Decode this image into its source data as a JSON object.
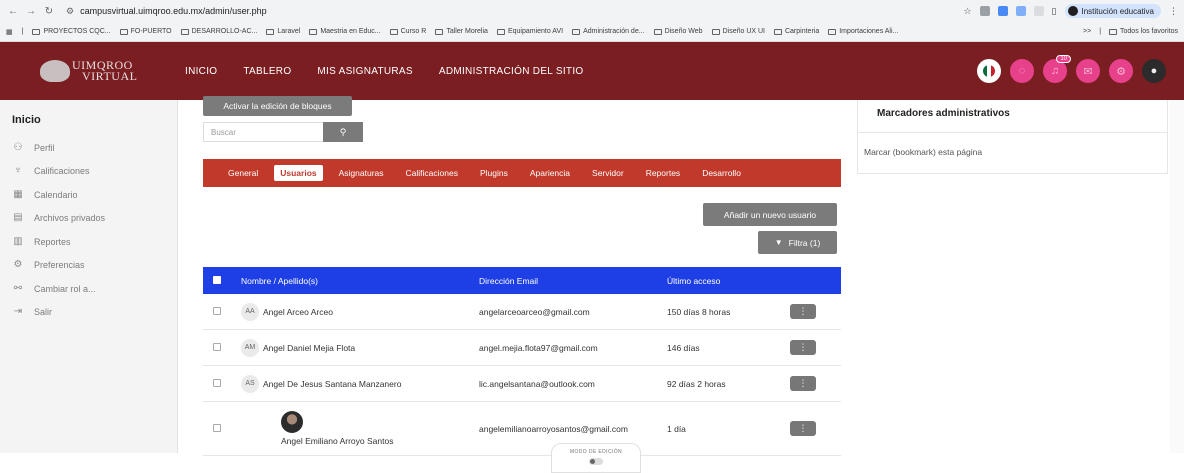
{
  "browser": {
    "url": "campusvirtual.uimqroo.edu.mx/admin/user.php",
    "profile_label": "Institución educativa",
    "bookmarks": [
      "PROYECTOS CQC...",
      "FO-PUERTO",
      "DESARROLLO-AC...",
      "Laravel",
      "Maestria en Educ...",
      "Curso R",
      "Taller Morelia",
      "Equipamiento AVI",
      "Administración de...",
      "Diseño Web",
      "Diseño UX UI",
      "Carpinteria",
      "Importaciones Ali..."
    ],
    "more_label": ">>",
    "all_bookmarks": "Todos los favoritos"
  },
  "header": {
    "logo_line1": "UIMQROO",
    "logo_line2": "VIRTUAL",
    "nav": [
      "INICIO",
      "TABLERO",
      "MIS ASIGNATURAS",
      "ADMINISTRACIÓN DEL SITIO"
    ],
    "notification_count": "10",
    "colors": {
      "header_bg": "#7a1e22",
      "icon_bg": "#e8418b"
    }
  },
  "sidebar": {
    "title": "Inicio",
    "items": [
      {
        "label": "Perfil",
        "icon": "profile-icon"
      },
      {
        "label": "Calificaciones",
        "icon": "grades-icon"
      },
      {
        "label": "Calendario",
        "icon": "calendar-icon"
      },
      {
        "label": "Archivos privados",
        "icon": "file-icon"
      },
      {
        "label": "Reportes",
        "icon": "reports-icon"
      },
      {
        "label": "Preferencias",
        "icon": "gear-icon"
      },
      {
        "label": "Cambiar rol a...",
        "icon": "switch-role-icon"
      },
      {
        "label": "Salir",
        "icon": "logout-icon"
      }
    ]
  },
  "main": {
    "edit_blocks_button": "Activar la edición de bloques",
    "search_placeholder": "Buscar",
    "tabs": [
      "General",
      "Usuarios",
      "Asignaturas",
      "Calificaciones",
      "Plugins",
      "Apariencia",
      "Servidor",
      "Reportes",
      "Desarrollo"
    ],
    "active_tab": "Usuarios",
    "add_user_button": "Añadir un nuevo usuario",
    "filter_button": "Filtra (1)",
    "columns": [
      "Nombre / Apellido(s)",
      "Dirección Email",
      "Último acceso"
    ],
    "users": [
      {
        "initials": "AA",
        "name": "Angel Arceo Arceo",
        "email": "angelarceoarceo@gmail.com",
        "last_access": "150 días 8 horas"
      },
      {
        "initials": "AM",
        "name": "Angel Daniel Mejia Flota",
        "email": "angel.mejia.flota97@gmail.com",
        "last_access": "146 días"
      },
      {
        "initials": "AS",
        "name": "Angel De Jesus Santana Manzanero",
        "email": "lic.angelsantana@outlook.com",
        "last_access": "92 días 2 horas"
      },
      {
        "initials": "",
        "name": "Angel Emiliano Arroyo Santos",
        "email": "angelemilianoarroyosantos@gmail.com",
        "last_access": "1 día"
      }
    ],
    "edit_mode_label": "MODO DE EDICIÓN",
    "colors": {
      "tabs_bg": "#c0392b",
      "table_header_bg": "#1f3fe6"
    }
  },
  "right_block": {
    "title": "Marcadores administrativos",
    "bookmark_link": "Marcar (bookmark) esta página"
  }
}
